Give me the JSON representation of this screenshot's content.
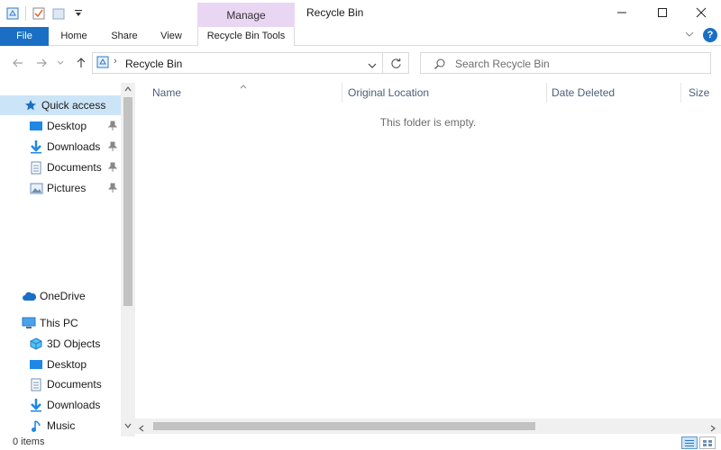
{
  "window": {
    "title": "Recycle Bin"
  },
  "ribbon": {
    "contextual_group": "Manage",
    "tabs": [
      "File",
      "Home",
      "Share",
      "View",
      "Recycle Bin Tools"
    ],
    "help": "?"
  },
  "address": {
    "path": "Recycle Bin"
  },
  "search": {
    "placeholder": "Search Recycle Bin"
  },
  "nav": {
    "quick_access": "Quick access",
    "quick_items": [
      "Desktop",
      "Downloads",
      "Documents",
      "Pictures"
    ],
    "onedrive": "OneDrive",
    "this_pc": "This PC",
    "pc_items": [
      "3D Objects",
      "Desktop",
      "Documents",
      "Downloads",
      "Music"
    ]
  },
  "columns": [
    "Name",
    "Original Location",
    "Date Deleted",
    "Size"
  ],
  "content": {
    "empty_message": "This folder is empty."
  },
  "status": {
    "item_count": "0 items"
  },
  "colors": {
    "accent": "#1a6fc4",
    "manage": "#e9d6f3",
    "selection": "#cce4f7",
    "header_text": "#4c607a"
  }
}
